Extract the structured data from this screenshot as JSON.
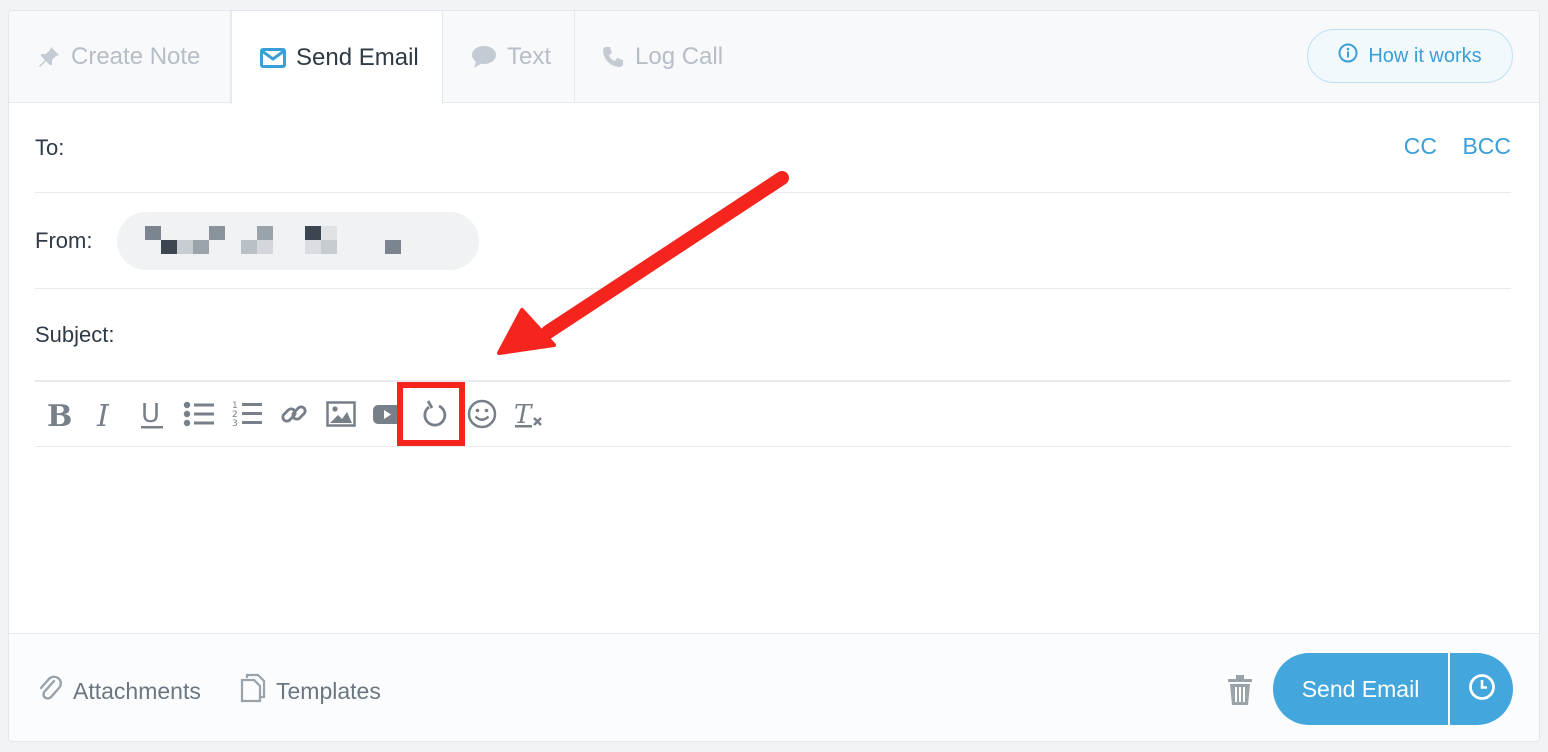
{
  "tabs": [
    {
      "label": "Create Note",
      "icon": "pin-icon",
      "active": false
    },
    {
      "label": "Send Email",
      "icon": "envelope-icon",
      "active": true
    },
    {
      "label": "Text",
      "icon": "speech-bubble-icon",
      "active": false
    },
    {
      "label": "Log Call",
      "icon": "phone-icon",
      "active": false
    }
  ],
  "help": {
    "label": "How it works",
    "icon": "info-circle-icon"
  },
  "to": {
    "label": "To:",
    "cc": "CC",
    "bcc": "BCC"
  },
  "from": {
    "label": "From:",
    "value_note": "redacted"
  },
  "subject": {
    "label": "Subject:"
  },
  "toolbar": {
    "items": [
      "bold-icon",
      "italic-icon",
      "underline-icon",
      "bulleted-list-icon",
      "numbered-list-icon",
      "link-icon",
      "image-icon",
      "video-icon",
      "ring-icon",
      "emoji-icon",
      "clear-format-icon"
    ],
    "highlighted": "ring-icon"
  },
  "footer": {
    "attachments": "Attachments",
    "templates": "Templates",
    "send": "Send Email"
  },
  "colors": {
    "accent": "#43a6dd",
    "link": "#3a9fd8",
    "highlight": "#f5241c",
    "text": "#2f3a45",
    "muted": "#b7bec6"
  }
}
